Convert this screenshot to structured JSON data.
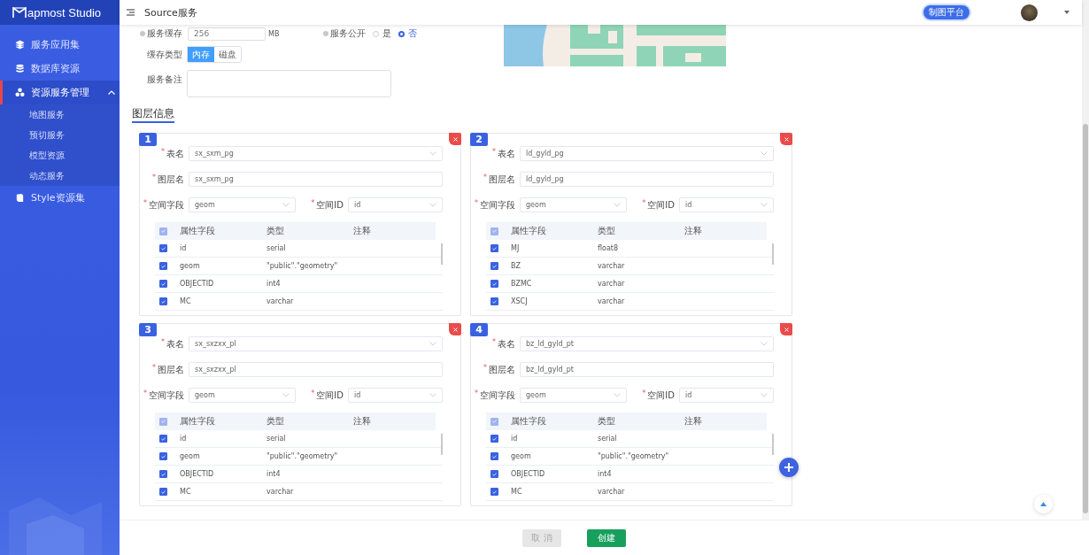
{
  "sidebar": {
    "logo_text": "apmost Studio",
    "items": [
      {
        "label": "服务应用集",
        "selected": false
      },
      {
        "label": "数据库资源",
        "selected": false
      },
      {
        "label": "资源服务管理",
        "selected": true,
        "expanded": true,
        "children": [
          {
            "label": "地图服务"
          },
          {
            "label": "预切服务"
          },
          {
            "label": "模型资源"
          },
          {
            "label": "动态服务"
          }
        ]
      },
      {
        "label": "Style资源集",
        "selected": false
      }
    ]
  },
  "header": {
    "title": "Source服务",
    "platform_badge": "制图平台"
  },
  "form": {
    "cache": {
      "label": "服务缓存",
      "value": "256",
      "unit": "MB"
    },
    "public": {
      "label": "服务公开",
      "options": [
        {
          "label": "是",
          "selected": false
        },
        {
          "label": "否",
          "selected": true
        }
      ]
    },
    "cache_type": {
      "label": "缓存类型",
      "options": [
        {
          "label": "内存",
          "selected": true
        },
        {
          "label": "磁盘",
          "selected": false
        }
      ]
    },
    "remark": {
      "label": "服务备注"
    }
  },
  "section_title": "图层信息",
  "layers": [
    {
      "number": "1",
      "fields": [
        {
          "mark": "*",
          "label": "表名",
          "value": "sx_sxm_pg",
          "kind": "select"
        },
        {
          "mark": "*",
          "label": "图层名",
          "value": "sx_sxm_pg",
          "kind": "input"
        }
      ],
      "geom": {
        "mark": "*",
        "label": "空间字段",
        "value": "geom"
      },
      "id": {
        "mark": "*",
        "label": "空间ID",
        "value": "id"
      },
      "columns": [
        "属性字段",
        "类型",
        "注释"
      ],
      "all_checked": true,
      "rows": [
        {
          "field": "id",
          "type": "serial",
          "checked": true
        },
        {
          "field": "geom",
          "type": "\"public\".\"geometry\"",
          "checked": true
        },
        {
          "field": "OBJECTID",
          "type": "int4",
          "checked": true
        },
        {
          "field": "MC",
          "type": "varchar",
          "checked": true
        }
      ]
    },
    {
      "number": "2",
      "fields": [
        {
          "mark": "*",
          "label": "表名",
          "value": "ld_gyld_pg",
          "kind": "select"
        },
        {
          "mark": "*",
          "label": "图层名",
          "value": "ld_gyld_pg",
          "kind": "input"
        }
      ],
      "geom": {
        "mark": "*",
        "label": "空间字段",
        "value": "geom"
      },
      "id": {
        "mark": "*",
        "label": "空间ID",
        "value": "id"
      },
      "columns": [
        "属性字段",
        "类型",
        "注释"
      ],
      "all_checked": true,
      "rows": [
        {
          "field": "MJ",
          "type": "float8",
          "checked": true
        },
        {
          "field": "BZ",
          "type": "varchar",
          "checked": true
        },
        {
          "field": "BZMC",
          "type": "varchar",
          "checked": true
        },
        {
          "field": "XSCJ",
          "type": "varchar",
          "checked": true
        }
      ]
    },
    {
      "number": "3",
      "fields": [
        {
          "mark": "*",
          "label": "表名",
          "value": "sx_sxzxx_pl",
          "kind": "select"
        },
        {
          "mark": "*",
          "label": "图层名",
          "value": "sx_sxzxx_pl",
          "kind": "input"
        }
      ],
      "geom": {
        "mark": "*",
        "label": "空间字段",
        "value": "geom"
      },
      "id": {
        "mark": "*",
        "label": "空间ID",
        "value": "id"
      },
      "columns": [
        "属性字段",
        "类型",
        "注释"
      ],
      "all_checked": true,
      "rows": [
        {
          "field": "id",
          "type": "serial",
          "checked": true
        },
        {
          "field": "geom",
          "type": "\"public\".\"geometry\"",
          "checked": true
        },
        {
          "field": "OBJECTID",
          "type": "int4",
          "checked": true
        },
        {
          "field": "MC",
          "type": "varchar",
          "checked": true
        }
      ]
    },
    {
      "number": "4",
      "fields": [
        {
          "mark": "*",
          "label": "表名",
          "value": "bz_ld_gyld_pt",
          "kind": "select"
        },
        {
          "mark": "*",
          "label": "图层名",
          "value": "bz_ld_gyld_pt",
          "kind": "input"
        }
      ],
      "geom": {
        "mark": "*",
        "label": "空间字段",
        "value": "geom"
      },
      "id": {
        "mark": "*",
        "label": "空间ID",
        "value": "id"
      },
      "columns": [
        "属性字段",
        "类型",
        "注释"
      ],
      "all_checked": true,
      "rows": [
        {
          "field": "id",
          "type": "serial",
          "checked": true
        },
        {
          "field": "geom",
          "type": "\"public\".\"geometry\"",
          "checked": true
        },
        {
          "field": "OBJECTID",
          "type": "int4",
          "checked": true
        },
        {
          "field": "MC",
          "type": "varchar",
          "checked": true
        }
      ]
    }
  ],
  "footer": {
    "cancel": {
      "label": "取 消",
      "disabled": true
    },
    "create": {
      "label": "创建"
    }
  }
}
